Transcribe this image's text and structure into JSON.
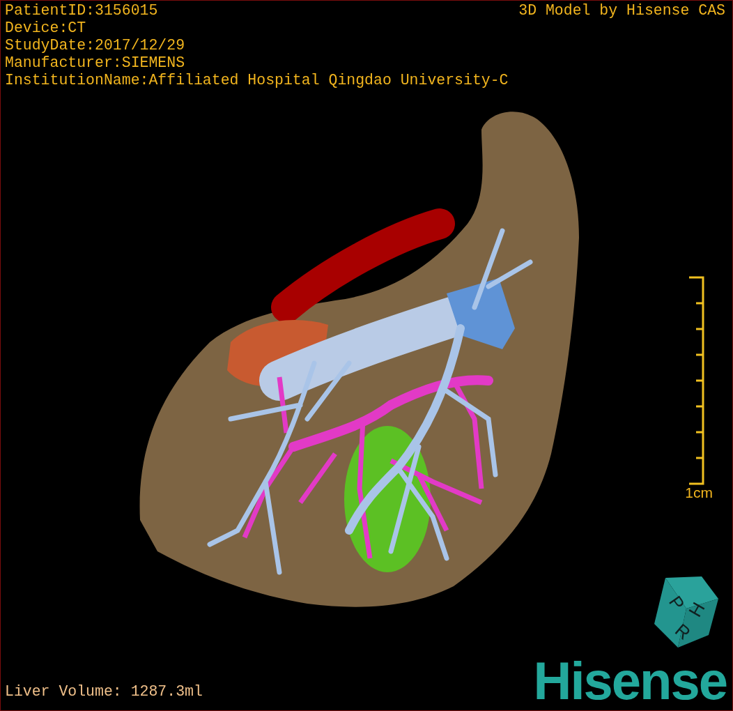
{
  "info_lines": [
    "PatientID:3156015",
    "Device:CT",
    "StudyDate:2017/12/29",
    "Manufacturer:SIEMENS",
    "InstitutionName:Affiliated Hospital Qingdao University-C"
  ],
  "credit": "3D Model by Hisense CAS",
  "scale_bar": {
    "label": "1cm"
  },
  "orientation_cube": {
    "labels": [
      "P",
      "H",
      "R"
    ]
  },
  "volume": "Liver Volume: 1287.3ml",
  "logo": "Hisense"
}
